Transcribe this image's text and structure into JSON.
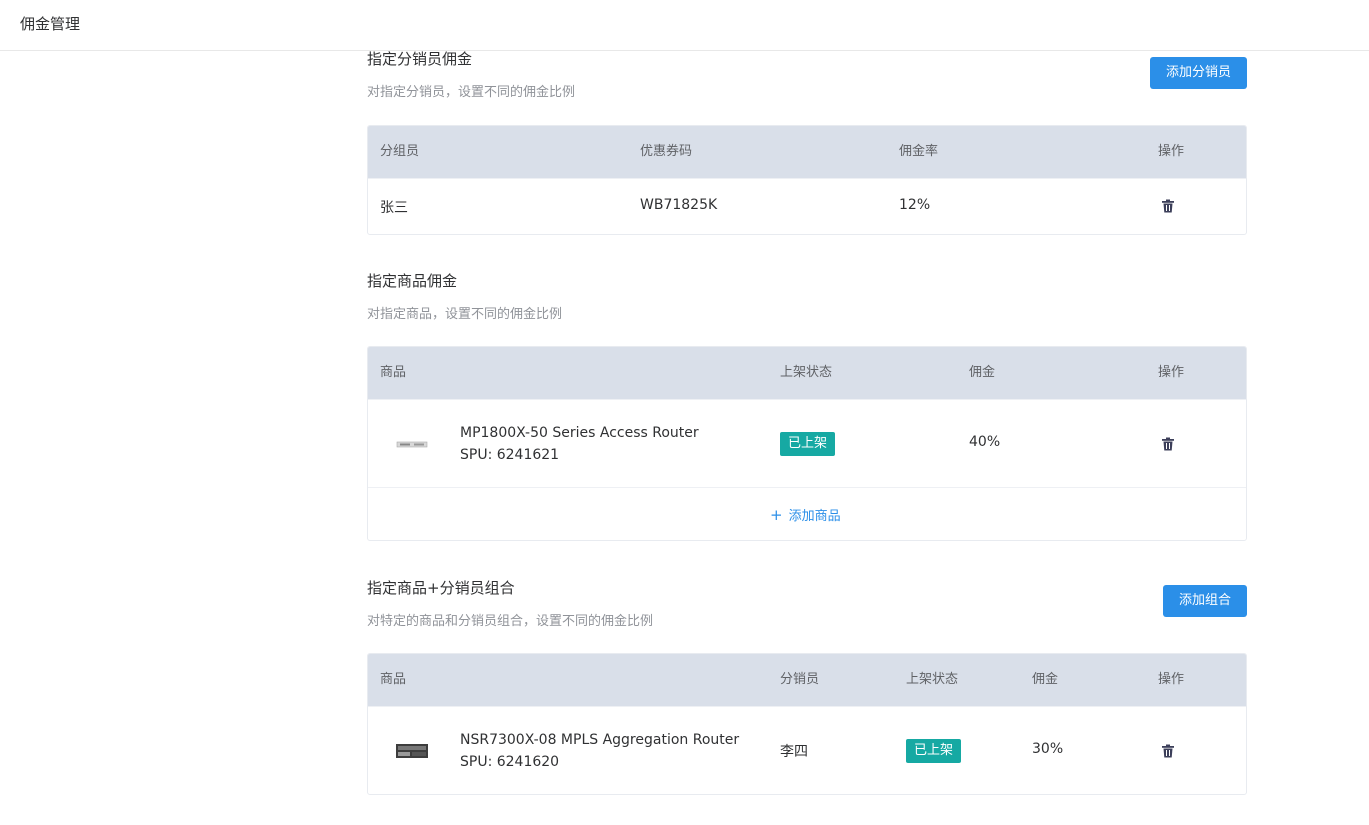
{
  "header": {
    "title": "佣金管理"
  },
  "section1": {
    "title": "指定分销员佣金",
    "desc": "对指定分销员，设置不同的佣金比例",
    "button_label": "添加分销员",
    "columns": [
      "分组员",
      "优惠券码",
      "佣金率",
      "操作"
    ],
    "rows": [
      {
        "name": "张三",
        "coupon": "WB71825K",
        "rate": "12%"
      }
    ]
  },
  "section2": {
    "title": "指定商品佣金",
    "desc": "对指定商品，设置不同的佣金比例",
    "columns": [
      "商品",
      "上架状态",
      "佣金",
      "操作"
    ],
    "rows": [
      {
        "product": "MP1800X-50 Series Access Router",
        "spu": "SPU: 6241621",
        "status": "已上架",
        "commission": "40%"
      }
    ],
    "add_label": "添加商品"
  },
  "section3": {
    "title": "指定商品+分销员组合",
    "desc": "对特定的商品和分销员组合，设置不同的佣金比例",
    "button_label": "添加组合",
    "columns": [
      "商品",
      "分销员",
      "上架状态",
      "佣金",
      "操作"
    ],
    "rows": [
      {
        "product": "NSR7300X-08 MPLS Aggregation Router",
        "spu": "SPU: 6241620",
        "distributor": "李四",
        "status": "已上架",
        "commission": "30%"
      }
    ]
  },
  "icons": {
    "delete": "trash-icon",
    "add": "plus-icon"
  },
  "colors": {
    "primary": "#2b8fe8",
    "status_badge": "#16a9a3",
    "table_header": "#d9dfe9"
  }
}
